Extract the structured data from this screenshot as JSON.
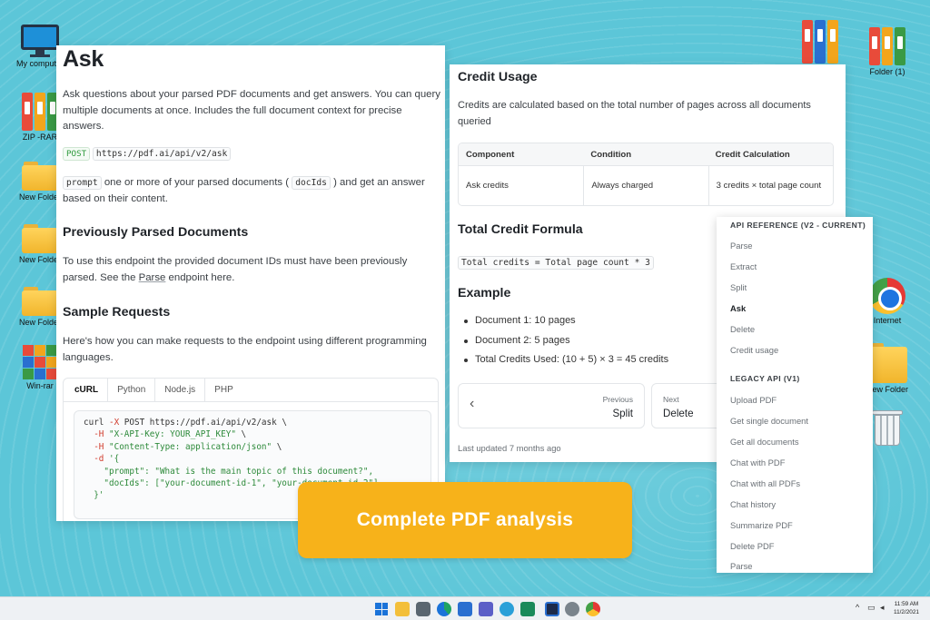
{
  "desktop": {
    "icons": [
      {
        "label": "My computer"
      },
      {
        "label": "ZIP -RAR"
      },
      {
        "label": "New Folder"
      },
      {
        "label": "New Folder"
      },
      {
        "label": "New Folder"
      },
      {
        "label": "Win-rar"
      },
      {
        "label": "Folder (1)"
      },
      {
        "label": "Internet"
      },
      {
        "label": "New Folder"
      }
    ]
  },
  "doc": {
    "title": "Ask",
    "intro": "Ask questions about your parsed PDF documents and get answers. You can query multiple documents at once. Includes the full document context for precise answers.",
    "method": "POST",
    "endpoint": "https://pdf.ai/api/v2/ask",
    "param_name": "prompt",
    "param_text_a": "one or more of your parsed documents (",
    "param_code": "docIds",
    "param_text_b": ") and get an answer based on their content.",
    "section_previous": "Previously Parsed Documents",
    "previous_text_a": "To use this endpoint the provided document IDs must have been previously parsed. See the",
    "previous_link": "Parse",
    "previous_text_b": "endpoint here.",
    "section_samples": "Sample Requests",
    "samples_text": "Here's how you can make requests to the endpoint using different programming languages.",
    "code_tabs": [
      "cURL",
      "Python",
      "Node.js",
      "PHP"
    ],
    "code": {
      "l1_flag": "-X",
      "l1_rest": " POST https://pdf.ai/api/v2/ask \\",
      "l1_cmd": "curl ",
      "l2_flag": "-H",
      "l2_str": "\"X-API-Key: YOUR_API_KEY\"",
      "l3_flag": "-H",
      "l3_str": "\"Content-Type: application/json\"",
      "l4_flag": "-d",
      "l4_str": "'{",
      "l5": "\"prompt\": \"What is the main topic of this document?\",",
      "l6": "\"docIds\": [\"your-document-id-1\", \"your-document-id-2\"]",
      "l7": "}'"
    }
  },
  "credit": {
    "title": "Credit Usage",
    "desc": "Credits are calculated based on the total number of pages across all documents queried",
    "table_headers": [
      "Component",
      "Condition",
      "Credit Calculation"
    ],
    "table_row": [
      "Ask credits",
      "Always charged",
      "3 credits × total page count"
    ],
    "formula_title": "Total Credit Formula",
    "formula": "Total credits = Total page count * 3",
    "example_title": "Example",
    "bullets": [
      "Document 1: 10 pages",
      "Document 2: 5 pages",
      "Total Credits Used: (10 + 5) × 3 = 45 credits"
    ],
    "prev_label": "Previous",
    "prev_title": "Split",
    "next_label": "Next",
    "next_title": "Delete",
    "updated": "Last updated 7 months ago"
  },
  "side_nav": {
    "section_current": "API REFERENCE (V2 - CURRENT)",
    "current_items": [
      "Parse",
      "Extract",
      "Split",
      "Ask",
      "Delete",
      "Credit usage"
    ],
    "section_legacy": "LEGACY API (V1)",
    "legacy_items": [
      "Upload PDF",
      "Get single document",
      "Get all documents",
      "Chat with PDF",
      "Chat with all PDFs",
      "Chat history",
      "Summarize PDF",
      "Delete PDF",
      "Parse"
    ]
  },
  "banner": {
    "text": "Complete PDF analysis"
  },
  "taskbar": {
    "time": "11:59 AM",
    "date": "11/2/2021"
  }
}
